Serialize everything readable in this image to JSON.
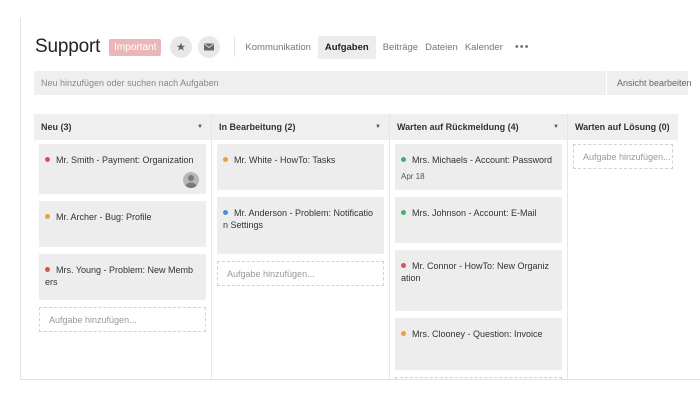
{
  "header": {
    "title": "Support",
    "badge": "Important",
    "nav": [
      {
        "label": "Kommunikation",
        "active": false
      },
      {
        "label": "Aufgaben",
        "active": true
      },
      {
        "label": "Beiträge",
        "active": false
      },
      {
        "label": "Dateien",
        "active": false
      },
      {
        "label": "Kalender",
        "active": false
      }
    ],
    "more": "•••"
  },
  "toolbar": {
    "search_placeholder": "Neu hinzufügen oder suchen nach Aufgaben",
    "view_label": "Ansicht bearbeiten"
  },
  "colors": {
    "red": "#d9534f",
    "orange": "#e8a33d",
    "green": "#4cae6e",
    "blue": "#4a8fd6"
  },
  "add_label": "Aufgabe hinzufügen...",
  "columns": [
    {
      "title": "Neu (3)",
      "cards": [
        {
          "title": "Mr. Smith - Payment: Organization",
          "color": "red",
          "avatar": true
        },
        {
          "title": "Mr. Archer - Bug: Profile",
          "color": "orange"
        },
        {
          "title": "Mrs. Young - Problem: New Memb ers",
          "color": "red"
        }
      ]
    },
    {
      "title": "In Bearbeitung (2)",
      "cards": [
        {
          "title": "Mr. White - HowTo: Tasks",
          "color": "orange"
        },
        {
          "title": "Mr. Anderson - Problem: Notificatio n Settings",
          "color": "blue"
        }
      ]
    },
    {
      "title": "Warten auf Rückmeldung (4)",
      "cards": [
        {
          "title": "Mrs. Michaels - Account: Password",
          "color": "green",
          "date": "Apr 18"
        },
        {
          "title": "Mrs. Johnson - Account: E-Mail",
          "color": "green"
        },
        {
          "title": "Mr. Connor - HowTo: New Organiz ation",
          "color": "red"
        },
        {
          "title": "Mrs. Clooney - Question: Invoice",
          "color": "orange"
        }
      ]
    },
    {
      "title": "Warten auf Lösung (0)",
      "cards": []
    }
  ]
}
